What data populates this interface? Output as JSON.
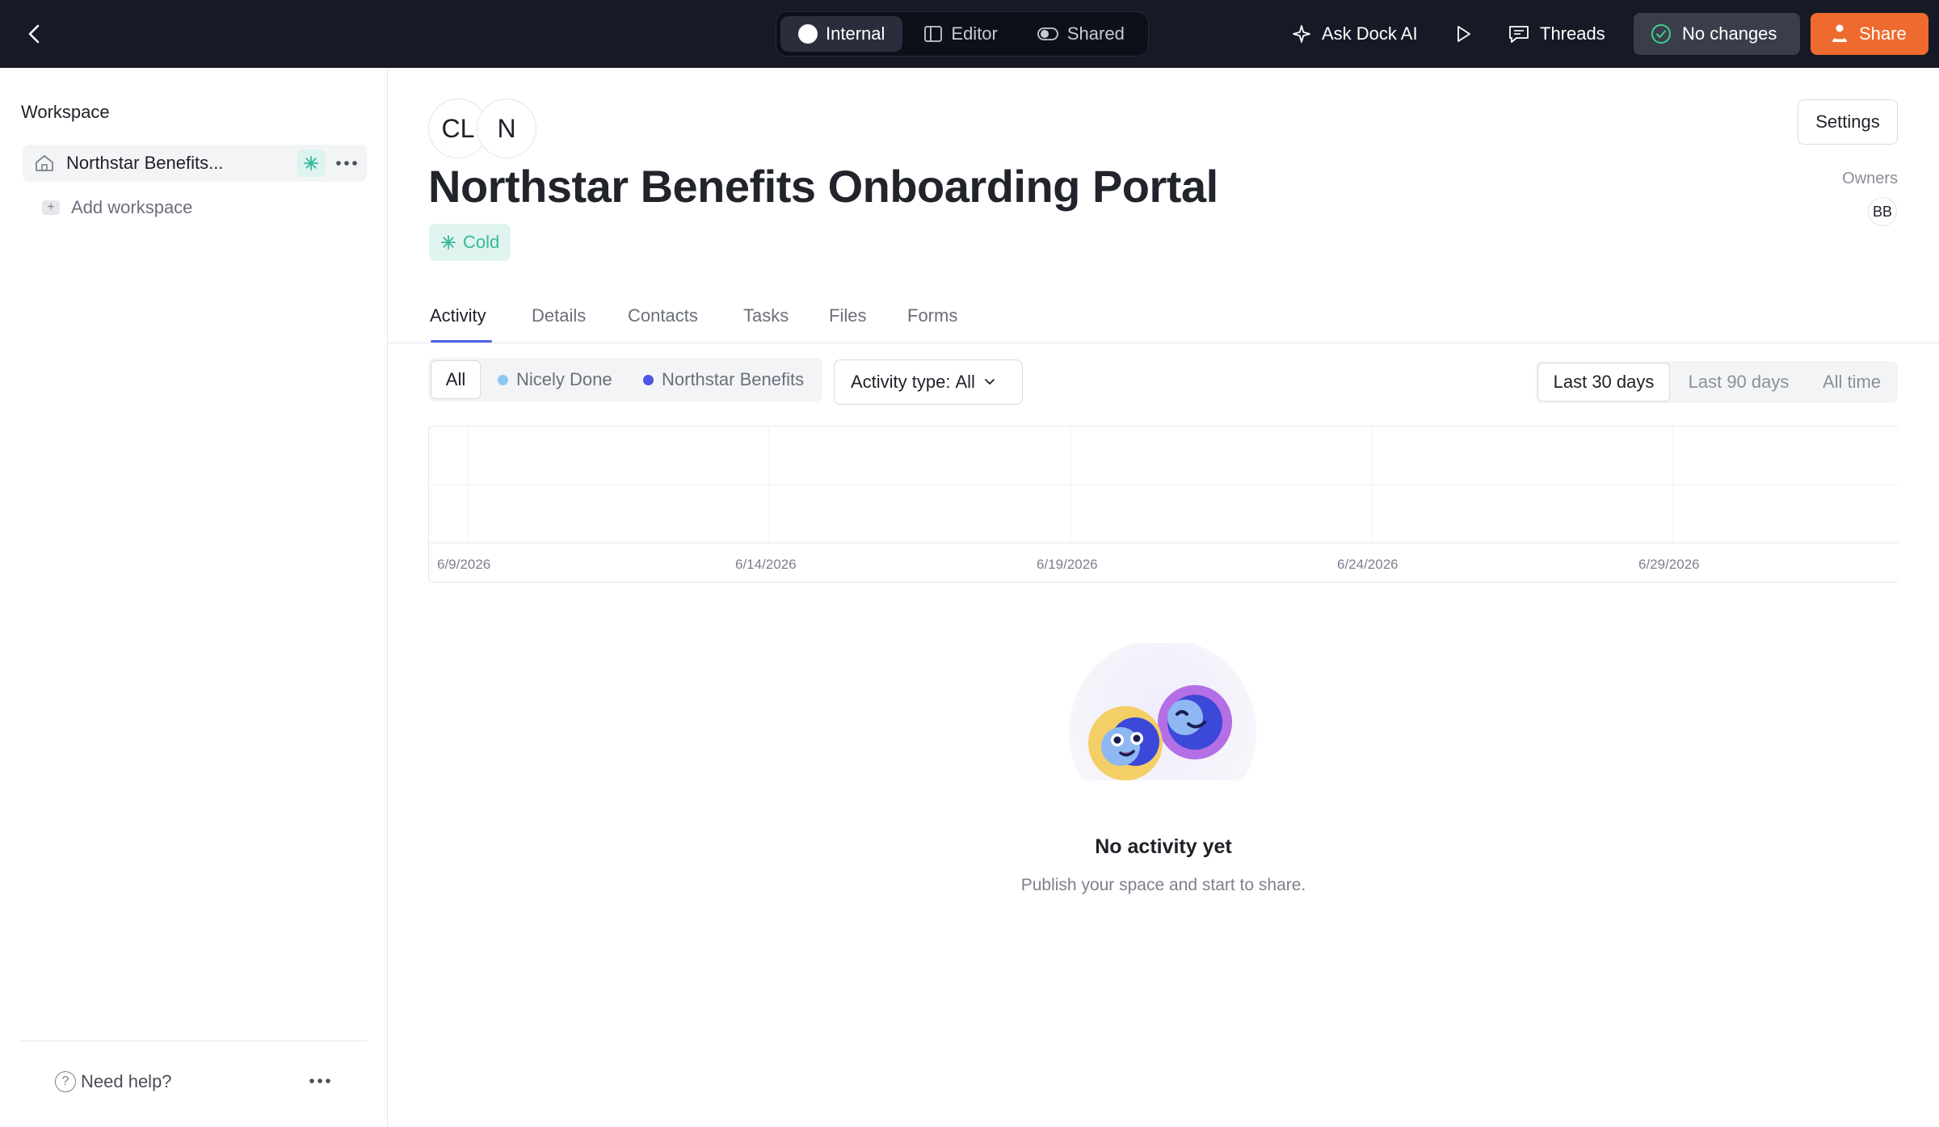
{
  "topbar": {
    "modes": [
      {
        "label": "Internal",
        "active": true
      },
      {
        "label": "Editor",
        "active": false
      },
      {
        "label": "Shared",
        "active": false
      }
    ],
    "ask_ai_label": "Ask Dock AI",
    "threads_label": "Threads",
    "no_changes_label": "No changes",
    "share_label": "Share"
  },
  "sidebar": {
    "heading": "Workspace",
    "workspace_name": "Northstar Benefits...",
    "add_workspace_label": "Add workspace",
    "help_label": "Need help?"
  },
  "header": {
    "avatars": [
      "CL",
      "N"
    ],
    "title": "Northstar Benefits Onboarding Portal",
    "status_tag": "Cold",
    "settings_label": "Settings",
    "owners_label": "Owners",
    "owner_initials": "BB"
  },
  "tabs": [
    {
      "label": "Activity",
      "active": true
    },
    {
      "label": "Details",
      "active": false
    },
    {
      "label": "Contacts",
      "active": false
    },
    {
      "label": "Tasks",
      "active": false
    },
    {
      "label": "Files",
      "active": false
    },
    {
      "label": "Forms",
      "active": false
    }
  ],
  "filters": {
    "all_label": "All",
    "options": [
      {
        "label": "Nicely Done",
        "color": "#8ec8f0"
      },
      {
        "label": "Northstar Benefits",
        "color": "#4f55e3"
      }
    ],
    "activity_type_prefix": "Activity type:",
    "activity_type_value": "All",
    "ranges": [
      {
        "label": "Last 30 days",
        "active": true
      },
      {
        "label": "Last 90 days",
        "active": false
      },
      {
        "label": "All time",
        "active": false
      }
    ]
  },
  "chart_data": {
    "type": "bar",
    "categories": [
      "6/9/2026",
      "6/14/2026",
      "6/19/2026",
      "6/24/2026",
      "6/29/2026"
    ],
    "values": [],
    "title": "",
    "xlabel": "",
    "ylabel": "",
    "grid": true
  },
  "empty_state": {
    "title": "No activity yet",
    "subtitle": "Publish your space and start to share."
  },
  "colors": {
    "topbar_bg": "#171a26",
    "share_orange": "#ee6a2e",
    "accent_blue": "#4f63e8",
    "cold_green": "#35b99a"
  }
}
